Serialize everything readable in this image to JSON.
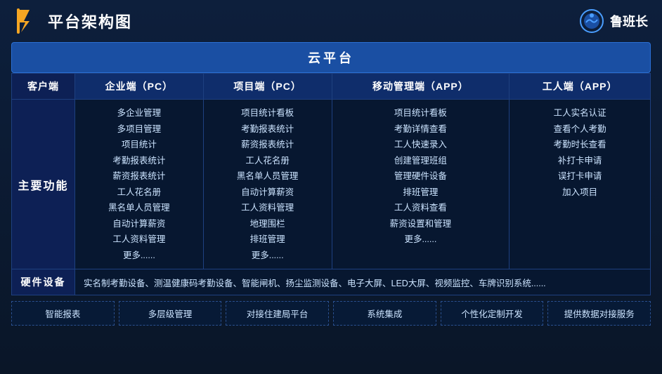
{
  "header": {
    "title": "平台架构图",
    "brand_name": "鲁班长"
  },
  "cloud_platform": {
    "label": "云平台"
  },
  "columns": [
    {
      "id": "client",
      "label": "客户端"
    },
    {
      "id": "enterprise",
      "label": "企业端（PC）"
    },
    {
      "id": "project_pc",
      "label": "项目端（PC）"
    },
    {
      "id": "mobile_app",
      "label": "移动管理端（APP）"
    },
    {
      "id": "worker_app",
      "label": "工人端（APP）"
    }
  ],
  "main_function_label": "主要功能",
  "features": {
    "enterprise": [
      "多企业管理",
      "多项目管理",
      "项目统计",
      "考勤报表统计",
      "薪资报表统计",
      "工人花名册",
      "黑名单人员管理",
      "自动计算薪资",
      "工人资料管理",
      "更多......"
    ],
    "project_pc": [
      "项目统计看板",
      "考勤报表统计",
      "薪资报表统计",
      "工人花名册",
      "黑名单人员管理",
      "自动计算薪资",
      "工人资料管理",
      "地理围栏",
      "排班管理",
      "更多......"
    ],
    "mobile_app": [
      "项目统计看板",
      "考勤详情查看",
      "工人快速录入",
      "创建管理班组",
      "管理硬件设备",
      "排班管理",
      "工人资料查看",
      "薪资设置和管理",
      "更多......"
    ],
    "worker_app": [
      "工人实名认证",
      "查看个人考勤",
      "考勤时长查看",
      "补打卡申请",
      "误打卡申请",
      "加入项目"
    ]
  },
  "hardware": {
    "label": "硬件设备",
    "content": "实名制考勤设备、测温健康码考勤设备、智能闸机、扬尘监测设备、电子大屏、LED大屏、视频监控、车牌识别系统......"
  },
  "bottom_items": [
    "智能报表",
    "多层级管理",
    "对接住建局平台",
    "系统集成",
    "个性化定制开发",
    "提供数据对接服务"
  ]
}
